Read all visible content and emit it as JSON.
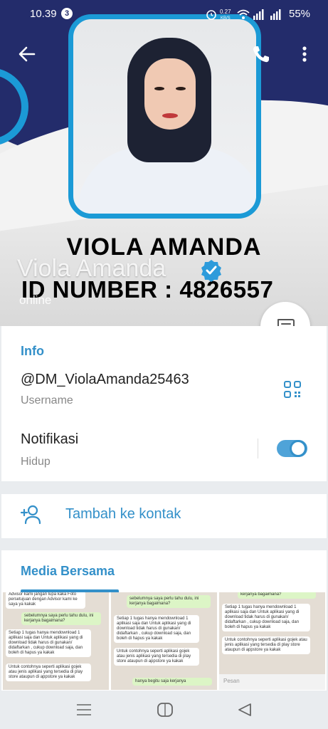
{
  "status_bar": {
    "time": "10.39",
    "notification_count": "3",
    "network_speed": "0.27",
    "network_unit": "KB/S",
    "battery": "55%"
  },
  "header": {
    "banner_name": "VIOLA AMANDA",
    "banner_id": "ID NUMBER : 4826557",
    "display_name": "Viola Amanda",
    "presence": "online"
  },
  "info": {
    "section_title": "Info",
    "username_value": "@DM_ViolaAmanda25463",
    "username_label": "Username",
    "notif_label": "Notifikasi",
    "notif_state": "Hidup",
    "notif_enabled": true
  },
  "actions": {
    "add_contact": "Tambah ke kontak"
  },
  "media": {
    "section_title": "Media Bersama",
    "thumbs": [
      {
        "messages": [
          {
            "text": "Advisor kami jangan lupa kaka Foto persetujuan dengan Advisor kami ke saya ya kakak",
            "out": false
          },
          {
            "text": "sebelumnya saya perlu tahu dulu, ini kerjanya bagaimana?",
            "out": true
          },
          {
            "text": "Setiap 1 tugas hanya mendownload 1 aplikasi saja dan Untuk aplikasi yang di download tidak harus di gunakan/ didaftarkan , cukup download saja, dan boleh di hapus ya kakak",
            "out": false
          },
          {
            "text": "Untuk contohnya seperti aplikasi gojek atau jenis aplikasi yang tersedia di play store ataupun di appstore ya kakak",
            "out": false
          }
        ]
      },
      {
        "messages": [
          {
            "text": "sebelumnya saya perlu tahu dulu, ini kerjanya bagaimana?",
            "out": true
          },
          {
            "text": "Setiap 1 tugas hanya mendownload 1 aplikasi saja dan Untuk aplikasi yang di download tidak harus di gunakan/ didaftarkan , cukup download saja, dan boleh di hapus ya kakak",
            "out": false
          },
          {
            "text": "Untuk contohnya seperti aplikasi gojek atau jenis aplikasi yang tersedia di play store ataupun di appstore ya kakak",
            "out": false
          },
          {
            "text": "hanya begitu saja kerjanya",
            "out": true
          }
        ]
      },
      {
        "messages": [
          {
            "text": "kerjanya bagaimana?",
            "out": true
          },
          {
            "text": "Setiap 1 tugas hanya mendownload 1 aplikasi saja dan Untuk aplikasi yang di download tidak harus di gunakan/ didaftarkan , cukup download saja, dan boleh di hapus ya kakak",
            "out": false
          },
          {
            "text": "Untuk contohnya seperti aplikasi gojek atau jenis aplikasi yang tersedia di play store ataupun di appstore ya kakak",
            "out": false
          }
        ],
        "input_placeholder": "Pesan"
      }
    ]
  },
  "colors": {
    "accent": "#3390c9",
    "navy": "#232c6b",
    "frame_blue": "#1b9ad6"
  }
}
